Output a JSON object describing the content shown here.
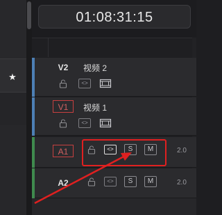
{
  "timecode": "01:08:31:15",
  "tracks": [
    {
      "id": "V2",
      "name": "视频 2",
      "level": "",
      "selected": false
    },
    {
      "id": "V1",
      "name": "视频 1",
      "level": "",
      "selected": true
    },
    {
      "id": "A1",
      "name": "",
      "level": "2.0",
      "selected": true
    },
    {
      "id": "A2",
      "name": "",
      "level": "2.0",
      "selected": false
    }
  ],
  "buttons": {
    "solo": "S",
    "mute": "M",
    "link": "<>"
  },
  "icons": {
    "star": "star-icon",
    "lock": "lock-icon",
    "film": "film-icon",
    "link": "link-icon"
  },
  "colors": {
    "video_track": "#4d7fb5",
    "audio_track": "#3f8a4e",
    "highlight": "#e02020",
    "track_id_selected": "#c84040"
  }
}
